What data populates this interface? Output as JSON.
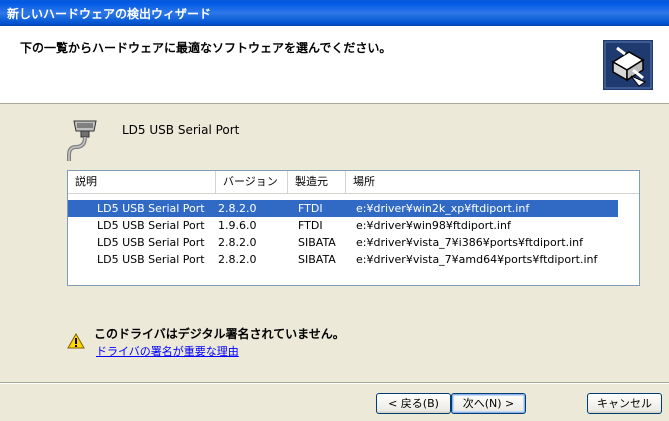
{
  "window": {
    "title": "新しいハードウェアの検出ウィザード"
  },
  "header": {
    "title": "下の一覧からハードウェアに最適なソフトウェアを選んでください。",
    "icon": "hardware-install-icon"
  },
  "device": {
    "name": "LD5 USB Serial Port",
    "icon": "serial-port-icon"
  },
  "list": {
    "columns": [
      "説明",
      "バージョン",
      "製造元",
      "場所"
    ],
    "rows": [
      {
        "desc": "LD5 USB Serial Port",
        "version": "2.8.2.0",
        "maker": "FTDI",
        "location": "e:¥driver¥win2k_xp¥ftdiport.inf",
        "selected": true
      },
      {
        "desc": "LD5 USB Serial Port",
        "version": "1.9.6.0",
        "maker": "FTDI",
        "location": "e:¥driver¥win98¥ftdiport.inf",
        "selected": false
      },
      {
        "desc": "LD5 USB Serial Port",
        "version": "2.8.2.0",
        "maker": "SIBATA",
        "location": "e:¥driver¥vista_7¥i386¥ports¥ftdiport.inf",
        "selected": false
      },
      {
        "desc": "LD5 USB Serial Port",
        "version": "2.8.2.0",
        "maker": "SIBATA",
        "location": "e:¥driver¥vista_7¥amd64¥ports¥ftdiport.inf",
        "selected": false
      }
    ]
  },
  "warning": {
    "text": "このドライバはデジタル署名されていません。",
    "link": "ドライバの署名が重要な理由",
    "icon": "warning-icon"
  },
  "buttons": {
    "back": "< 戻る(B)",
    "next": "次へ(N) >",
    "cancel": "キャンセル"
  },
  "colors": {
    "selection": "#316AC5",
    "titlebar": "#0058E6",
    "dialog": "#ECE9D8"
  }
}
